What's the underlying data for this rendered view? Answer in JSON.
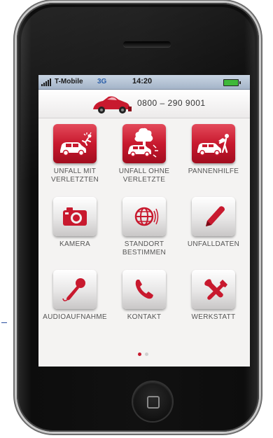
{
  "status_bar": {
    "carrier": "T-Mobile",
    "network": "3G",
    "time": "14:20"
  },
  "header": {
    "phone_number": "0800 – 290 9001"
  },
  "tiles": [
    {
      "label_line1": "UNFALL MIT",
      "label_line2": "VERLETZTEN",
      "style": "red",
      "icon": "car-accident-person-icon"
    },
    {
      "label_line1": "UNFALL OHNE",
      "label_line2": "VERLETZTE",
      "style": "red",
      "icon": "car-tree-accident-icon"
    },
    {
      "label_line1": "PANNENHILFE",
      "label_line2": "",
      "style": "red",
      "icon": "car-breakdown-icon"
    },
    {
      "label_line1": "KAMERA",
      "label_line2": "",
      "style": "gray",
      "icon": "camera-icon"
    },
    {
      "label_line1": "STANDORT",
      "label_line2": "BESTIMMEN",
      "style": "gray",
      "icon": "globe-location-icon"
    },
    {
      "label_line1": "UNFALLDATEN",
      "label_line2": "",
      "style": "gray",
      "icon": "pencil-icon"
    },
    {
      "label_line1": "AUDIOAUFNAHME",
      "label_line2": "",
      "style": "gray",
      "icon": "microphone-icon"
    },
    {
      "label_line1": "KONTAKT",
      "label_line2": "",
      "style": "gray",
      "icon": "phone-handset-icon"
    },
    {
      "label_line1": "WERKSTATT",
      "label_line2": "",
      "style": "gray",
      "icon": "tools-icon"
    }
  ],
  "pagination": {
    "pages": 2,
    "current": 1
  },
  "colors": {
    "brand_red": "#c8192e",
    "background": "#f4f3f2"
  }
}
